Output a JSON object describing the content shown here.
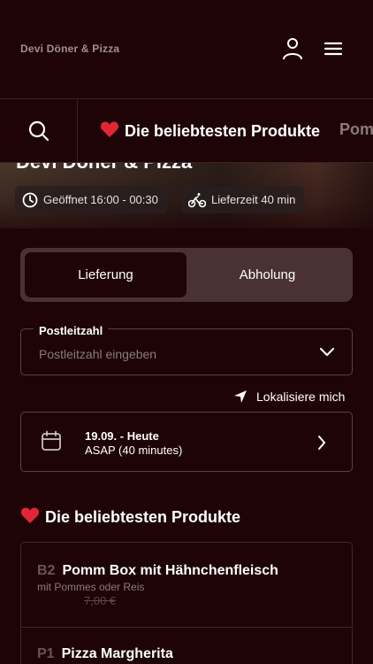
{
  "header": {
    "brand": "Devi Döner & Pizza",
    "user_icon": "user-icon",
    "menu_icon": "hamburger-menu-icon"
  },
  "category_bar": {
    "search_icon": "search-icon",
    "active_category": "Die beliebtesten Produkte",
    "next_category": "Pom",
    "heart_icon": "heart-icon"
  },
  "hero": {
    "title": "Devi Döner & Pizza",
    "opening_hours": "Geöffnet 16:00 - 00:30",
    "delivery_time": "Lieferzeit 40 min"
  },
  "order_mode": {
    "delivery_label": "Lieferung",
    "pickup_label": "Abholung",
    "selected": "Lieferung"
  },
  "postcode": {
    "label": "Postleitzahl",
    "placeholder": "Postleitzahl eingeben",
    "value": ""
  },
  "locate": {
    "label": "Lokalisiere mich"
  },
  "schedule": {
    "date_line": "19.09. - Heute",
    "time_line": "ASAP (40 minutes)"
  },
  "popular": {
    "title": "Die beliebtesten Produkte",
    "products": [
      {
        "code": "B2",
        "name": "Pomm Box mit Hähnchenfleisch",
        "description": "mit Pommes oder Reis",
        "price": "7,00 €"
      },
      {
        "code": "P1",
        "name": "Pizza Margherita"
      }
    ]
  },
  "colors": {
    "background": "#1e0406",
    "toggle_track": "#4a3234",
    "heart": "#e32636",
    "border": "#5a4244"
  }
}
